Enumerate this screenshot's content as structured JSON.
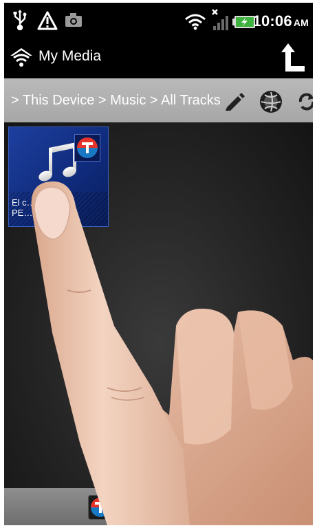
{
  "status_bar": {
    "icons": [
      "usb-icon",
      "warning-icon",
      "camera-icon",
      "wifi-icon",
      "signal-icon",
      "battery-charging-icon"
    ],
    "time": "10:06",
    "ampm": "AM"
  },
  "app_bar": {
    "title": "My Media",
    "logo_icon": "wifi-home-icon",
    "up_icon": "up-arrow-icon"
  },
  "breadcrumb": {
    "path": "> This Device > Music > All Tracks",
    "actions": [
      "edit-icon",
      "globe-icon",
      "refresh-icon"
    ]
  },
  "tracks": [
    {
      "title": "El c…sa -",
      "subtitle": "PE…",
      "icon": "music-note-icon",
      "badge": "T"
    }
  ],
  "bottom_bar": {
    "badge": "T"
  },
  "colors": {
    "tile": "#123587",
    "breadcrumb_bg": "#b0b0b0",
    "badge_red": "#e8332b",
    "badge_blue": "#1a78c2"
  }
}
